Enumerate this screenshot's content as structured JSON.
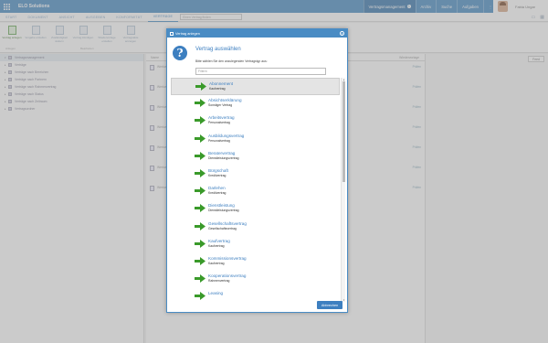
{
  "app": {
    "brand": "ELO Solutions"
  },
  "topbar": {
    "tabs": [
      {
        "label": "Vertragsmanagement",
        "badge": "3",
        "active": true
      },
      {
        "label": "Archiv",
        "active": false
      },
      {
        "label": "Suche",
        "active": false
      },
      {
        "label": "Aufgaben",
        "active": false
      }
    ],
    "user": "Fabia Ungar"
  },
  "menubar": {
    "items": [
      {
        "label": "START",
        "active": false
      },
      {
        "label": "DOKUMENT",
        "active": false
      },
      {
        "label": "ANSICHT",
        "active": false
      },
      {
        "label": "AUSGEBEN",
        "active": false
      },
      {
        "label": "KONFORMITÄT",
        "active": false
      },
      {
        "label": "VERTRÄGE",
        "active": true
      }
    ],
    "search_placeholder": "Einen Vertrag finden"
  },
  "ribbon": {
    "items": [
      "Vertrag anlegen",
      "Vorgabe erstellen",
      "Zuständigkeit ändern",
      "Vertrag kündigen",
      "Wiedervorlage erstellen",
      "Vertragsakte anzeigen"
    ],
    "groups": [
      "Anlegen",
      "Bearbeiten"
    ]
  },
  "tree": {
    "root": "Vertragsmanagement",
    "items": [
      "Verträge",
      "Verträge nach Bereichen",
      "Verträge nach Partnern",
      "Verträge nach Rahmenvertrag",
      "Verträge nach Status",
      "Verträge nach Zeitraum",
      "Vertragsordner"
    ]
  },
  "center": {
    "column_header": "Name",
    "status_header": "Wiedervorlage",
    "rows": [
      {
        "name": "Werkvertrag",
        "status": "Prüfen"
      },
      {
        "name": "Werkvertrag",
        "status": "Prüfen"
      },
      {
        "name": "Werkvertrag",
        "status": "Prüfen"
      },
      {
        "name": "Werkvertrag",
        "status": "Prüfen"
      },
      {
        "name": "Werkvertrag",
        "status": "Prüfen"
      },
      {
        "name": "Werkvertrag",
        "status": "Prüfen"
      },
      {
        "name": "Werkvertrag",
        "status": "Prüfen"
      }
    ]
  },
  "right": {
    "feed_button": "Feed"
  },
  "dialog": {
    "title": "Vertrag anlegen",
    "heading": "Vertrag auswählen",
    "subtitle": "Bitte wählen Sie den anzulegenden Vertragstyp aus:",
    "filter_placeholder": "Filtern",
    "cancel_label": "Abbrechen",
    "items": [
      {
        "name": "Abonnement",
        "type": "Kaufvertrag",
        "selected": true
      },
      {
        "name": "Absichtserklärung",
        "type": "Sonstiger Vertrag",
        "selected": false
      },
      {
        "name": "Arbeitsvertrag",
        "type": "Personalvertrag",
        "selected": false
      },
      {
        "name": "Ausbildungsvertrag",
        "type": "Personalvertrag",
        "selected": false
      },
      {
        "name": "Beratervertrag",
        "type": "Dienstleistungsvertrag",
        "selected": false
      },
      {
        "name": "Bürgschaft",
        "type": "Kreditvertrag",
        "selected": false
      },
      {
        "name": "Darlehen",
        "type": "Kreditvertrag",
        "selected": false
      },
      {
        "name": "Dienstleistung",
        "type": "Dienstleistungsvertrag",
        "selected": false
      },
      {
        "name": "Gesellschaftsvertrag",
        "type": "Gesellschaftsvertrag",
        "selected": false
      },
      {
        "name": "Kaufvertrag",
        "type": "Kaufvertrag",
        "selected": false
      },
      {
        "name": "Kommissionsvertrag",
        "type": "Kaufvertrag",
        "selected": false
      },
      {
        "name": "Kooperationsvertrag",
        "type": "Rahmenvertrag",
        "selected": false
      },
      {
        "name": "Leasing",
        "type": "",
        "selected": false
      }
    ]
  },
  "colors": {
    "accent": "#4a8cc4",
    "arrow": "#3a9a2a"
  }
}
